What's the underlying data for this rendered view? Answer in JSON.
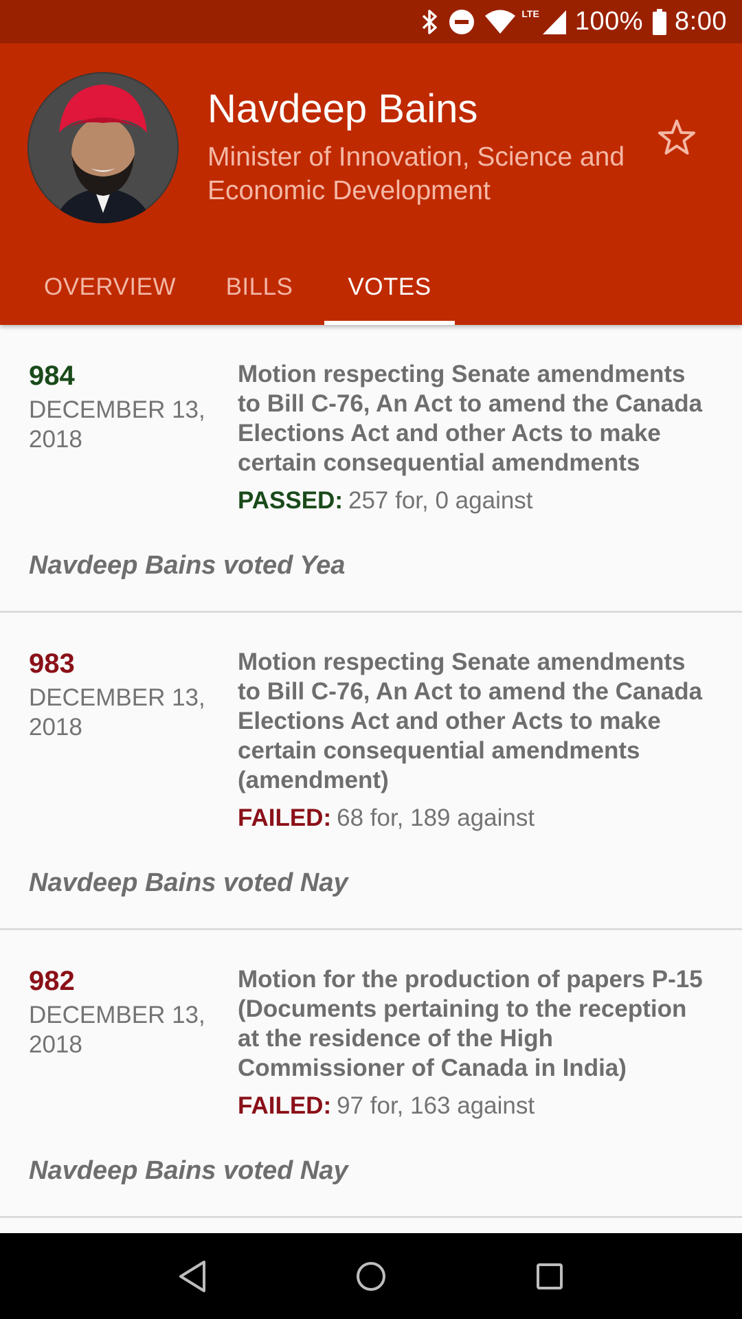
{
  "status_bar": {
    "network": "LTE",
    "battery": "100%",
    "time": "8:00"
  },
  "profile": {
    "name": "Navdeep Bains",
    "title": "Minister of Innovation, Science and Economic Development",
    "favorite_icon": "star-outline-icon"
  },
  "tabs": [
    {
      "label": "OVERVIEW",
      "active": false
    },
    {
      "label": "BILLS",
      "active": false
    },
    {
      "label": "VOTES",
      "active": true
    }
  ],
  "votes": [
    {
      "number": "984",
      "date": "DECEMBER 13, 2018",
      "description": "Motion respecting Senate amendments to Bill C-76, An Act to amend the Canada Elections Act and other Acts to make certain consequential amendments",
      "result_label": "PASSED:",
      "result_counts": "257 for, 0 against",
      "status": "passed",
      "member_vote": "Navdeep Bains voted Yea"
    },
    {
      "number": "983",
      "date": "DECEMBER 13, 2018",
      "description": "Motion respecting Senate amendments to Bill C-76, An Act to amend the Canada Elections Act and other Acts to make certain consequential amendments (amendment)",
      "result_label": "FAILED:",
      "result_counts": "68 for, 189 against",
      "status": "failed",
      "member_vote": "Navdeep Bains voted Nay"
    },
    {
      "number": "982",
      "date": "DECEMBER 13, 2018",
      "description": "Motion for the production of papers P-15 (Documents pertaining to the reception at the residence of the High Commissioner of Canada in India)",
      "result_label": "FAILED:",
      "result_counts": "97 for, 163 against",
      "status": "failed",
      "member_vote": "Navdeep Bains voted Nay"
    }
  ],
  "colors": {
    "status_bar": "#9a2100",
    "header": "#c02a00",
    "passed": "#1a4a1a",
    "failed": "#8a1018"
  }
}
